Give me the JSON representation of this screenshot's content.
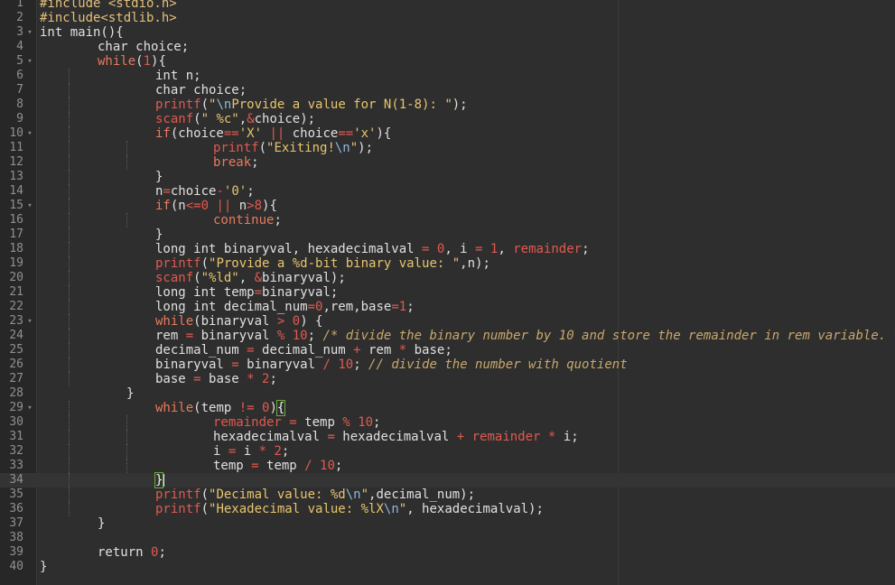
{
  "editor": {
    "lines": [
      {
        "n": "1",
        "fold": "",
        "indent": 0,
        "tokens": [
          [
            "pp",
            "#include <stdio.h>"
          ]
        ]
      },
      {
        "n": "2",
        "fold": "",
        "indent": 0,
        "tokens": [
          [
            "pp",
            "#include<stdlib.h>"
          ]
        ]
      },
      {
        "n": "3",
        "fold": "▾",
        "indent": 0,
        "tokens": [
          [
            "kw",
            "int main(){"
          ]
        ]
      },
      {
        "n": "4",
        "fold": "",
        "indent": 1,
        "tokens": [
          [
            "kw",
            "char choice;"
          ]
        ]
      },
      {
        "n": "5",
        "fold": "▾",
        "indent": 1,
        "tokens": [
          [
            "kwf",
            "while"
          ],
          [
            "kw",
            "("
          ],
          [
            "num",
            "1"
          ],
          [
            "kw",
            "){"
          ]
        ]
      },
      {
        "n": "6",
        "fold": "",
        "indent": 2,
        "tokens": [
          [
            "kw",
            "int n;"
          ]
        ]
      },
      {
        "n": "7",
        "fold": "",
        "indent": 2,
        "tokens": [
          [
            "kw",
            "char choice;"
          ]
        ]
      },
      {
        "n": "8",
        "fold": "",
        "indent": 2,
        "tokens": [
          [
            "fn",
            "printf"
          ],
          [
            "kw",
            "("
          ],
          [
            "str",
            "\""
          ],
          [
            "esc",
            "\\n"
          ],
          [
            "str",
            "Provide a value for N(1-8): \""
          ],
          [
            "kw",
            ");"
          ]
        ]
      },
      {
        "n": "9",
        "fold": "",
        "indent": 2,
        "tokens": [
          [
            "fn",
            "scanf"
          ],
          [
            "kw",
            "("
          ],
          [
            "str",
            "\" %c\""
          ],
          [
            "kw",
            ","
          ],
          [
            "op",
            "&"
          ],
          [
            "kw",
            "choice);"
          ]
        ]
      },
      {
        "n": "10",
        "fold": "▾",
        "indent": 2,
        "tokens": [
          [
            "kwf",
            "if"
          ],
          [
            "kw",
            "(choice"
          ],
          [
            "op",
            "=="
          ],
          [
            "str",
            "'X'"
          ],
          [
            "kw",
            " "
          ],
          [
            "op",
            "||"
          ],
          [
            "kw",
            " choice"
          ],
          [
            "op",
            "=="
          ],
          [
            "str",
            "'x'"
          ],
          [
            "kw",
            "){"
          ]
        ]
      },
      {
        "n": "11",
        "fold": "",
        "indent": 3,
        "tokens": [
          [
            "fn",
            "printf"
          ],
          [
            "kw",
            "("
          ],
          [
            "str",
            "\"Exiting!"
          ],
          [
            "esc",
            "\\n"
          ],
          [
            "str",
            "\""
          ],
          [
            "kw",
            ");"
          ]
        ]
      },
      {
        "n": "12",
        "fold": "",
        "indent": 3,
        "tokens": [
          [
            "kwf",
            "break"
          ],
          [
            "kw",
            ";"
          ]
        ]
      },
      {
        "n": "13",
        "fold": "",
        "indent": 2,
        "tokens": [
          [
            "kw",
            "}"
          ]
        ]
      },
      {
        "n": "14",
        "fold": "",
        "indent": 2,
        "tokens": [
          [
            "kw",
            "n"
          ],
          [
            "op",
            "="
          ],
          [
            "kw",
            "choice"
          ],
          [
            "op",
            "-"
          ],
          [
            "str",
            "'0'"
          ],
          [
            "kw",
            ";"
          ]
        ]
      },
      {
        "n": "15",
        "fold": "▾",
        "indent": 2,
        "tokens": [
          [
            "kwf",
            "if"
          ],
          [
            "kw",
            "(n"
          ],
          [
            "op",
            "<="
          ],
          [
            "num",
            "0"
          ],
          [
            "kw",
            " "
          ],
          [
            "op",
            "||"
          ],
          [
            "kw",
            " n"
          ],
          [
            "op",
            ">"
          ],
          [
            "num",
            "8"
          ],
          [
            "kw",
            "){"
          ]
        ]
      },
      {
        "n": "16",
        "fold": "",
        "indent": 3,
        "tokens": [
          [
            "kwf",
            "continue"
          ],
          [
            "kw",
            ";"
          ]
        ]
      },
      {
        "n": "17",
        "fold": "",
        "indent": 2,
        "tokens": [
          [
            "kw",
            "}"
          ]
        ]
      },
      {
        "n": "18",
        "fold": "",
        "indent": 2,
        "tokens": [
          [
            "kw",
            "long int binaryval, hexadecimalval "
          ],
          [
            "op",
            "="
          ],
          [
            "kw",
            " "
          ],
          [
            "num",
            "0"
          ],
          [
            "kw",
            ", i "
          ],
          [
            "op",
            "="
          ],
          [
            "kw",
            " "
          ],
          [
            "num",
            "1"
          ],
          [
            "kw",
            ", "
          ],
          [
            "red",
            "remainder"
          ],
          [
            "kw",
            ";"
          ]
        ]
      },
      {
        "n": "19",
        "fold": "",
        "indent": 2,
        "tokens": [
          [
            "fn",
            "printf"
          ],
          [
            "kw",
            "("
          ],
          [
            "str",
            "\"Provide a %d-bit binary value: \""
          ],
          [
            "kw",
            ",n);"
          ]
        ]
      },
      {
        "n": "20",
        "fold": "",
        "indent": 2,
        "tokens": [
          [
            "fn",
            "scanf"
          ],
          [
            "kw",
            "("
          ],
          [
            "str",
            "\"%ld\""
          ],
          [
            "kw",
            ", "
          ],
          [
            "op",
            "&"
          ],
          [
            "kw",
            "binaryval);"
          ]
        ]
      },
      {
        "n": "21",
        "fold": "",
        "indent": 2,
        "tokens": [
          [
            "kw",
            "long int temp"
          ],
          [
            "op",
            "="
          ],
          [
            "kw",
            "binaryval;"
          ]
        ]
      },
      {
        "n": "22",
        "fold": "",
        "indent": 2,
        "tokens": [
          [
            "kw",
            "long int decimal_num"
          ],
          [
            "op",
            "="
          ],
          [
            "num",
            "0"
          ],
          [
            "kw",
            ",rem,base"
          ],
          [
            "op",
            "="
          ],
          [
            "num",
            "1"
          ],
          [
            "kw",
            ";"
          ]
        ]
      },
      {
        "n": "23",
        "fold": "▾",
        "indent": 2,
        "tokens": [
          [
            "kwf",
            "while"
          ],
          [
            "kw",
            "(binaryval "
          ],
          [
            "op",
            ">"
          ],
          [
            "kw",
            " "
          ],
          [
            "num",
            "0"
          ],
          [
            "kw",
            ") {"
          ]
        ]
      },
      {
        "n": "24",
        "fold": "",
        "indent": 2,
        "tokens": [
          [
            "kw",
            "rem "
          ],
          [
            "op",
            "="
          ],
          [
            "kw",
            " binaryval "
          ],
          [
            "op",
            "%"
          ],
          [
            "kw",
            " "
          ],
          [
            "num",
            "10"
          ],
          [
            "kw",
            "; "
          ],
          [
            "cm",
            "/* divide the binary number by 10 and store the remainder in rem variable. */"
          ]
        ]
      },
      {
        "n": "25",
        "fold": "",
        "indent": 2,
        "tokens": [
          [
            "kw",
            "decimal_num "
          ],
          [
            "op",
            "="
          ],
          [
            "kw",
            " decimal_num "
          ],
          [
            "op",
            "+"
          ],
          [
            "kw",
            " rem "
          ],
          [
            "op",
            "*"
          ],
          [
            "kw",
            " base;"
          ]
        ]
      },
      {
        "n": "26",
        "fold": "",
        "indent": 2,
        "tokens": [
          [
            "kw",
            "binaryval "
          ],
          [
            "op",
            "="
          ],
          [
            "kw",
            " binaryval "
          ],
          [
            "op",
            "/"
          ],
          [
            "kw",
            " "
          ],
          [
            "num",
            "10"
          ],
          [
            "kw",
            "; "
          ],
          [
            "cm",
            "// divide the number with quotient"
          ]
        ]
      },
      {
        "n": "27",
        "fold": "",
        "indent": 2,
        "tokens": [
          [
            "kw",
            "base "
          ],
          [
            "op",
            "="
          ],
          [
            "kw",
            " base "
          ],
          [
            "op",
            "*"
          ],
          [
            "kw",
            " "
          ],
          [
            "num",
            "2"
          ],
          [
            "kw",
            ";"
          ]
        ]
      },
      {
        "n": "28",
        "fold": "",
        "indent": 1.5,
        "tokens": [
          [
            "kw",
            "}"
          ]
        ]
      },
      {
        "n": "29",
        "fold": "▾",
        "indent": 2,
        "tokens": [
          [
            "kwf",
            "while"
          ],
          [
            "kw",
            "(temp "
          ],
          [
            "op",
            "!="
          ],
          [
            "kw",
            " "
          ],
          [
            "num",
            "0"
          ],
          [
            "kw",
            ")"
          ],
          [
            "bm",
            "{"
          ]
        ]
      },
      {
        "n": "30",
        "fold": "",
        "indent": 3,
        "tokens": [
          [
            "red",
            "remainder"
          ],
          [
            "kw",
            " "
          ],
          [
            "op",
            "="
          ],
          [
            "kw",
            " temp "
          ],
          [
            "op",
            "%"
          ],
          [
            "kw",
            " "
          ],
          [
            "num",
            "10"
          ],
          [
            "kw",
            ";"
          ]
        ]
      },
      {
        "n": "31",
        "fold": "",
        "indent": 3,
        "tokens": [
          [
            "kw",
            "hexadecimalval "
          ],
          [
            "op",
            "="
          ],
          [
            "kw",
            " hexadecimalval "
          ],
          [
            "op",
            "+"
          ],
          [
            "kw",
            " "
          ],
          [
            "red",
            "remainder"
          ],
          [
            "kw",
            " "
          ],
          [
            "op",
            "*"
          ],
          [
            "kw",
            " i;"
          ]
        ]
      },
      {
        "n": "32",
        "fold": "",
        "indent": 3,
        "tokens": [
          [
            "kw",
            "i "
          ],
          [
            "op",
            "="
          ],
          [
            "kw",
            " i "
          ],
          [
            "op",
            "*"
          ],
          [
            "kw",
            " "
          ],
          [
            "num",
            "2"
          ],
          [
            "kw",
            ";"
          ]
        ]
      },
      {
        "n": "33",
        "fold": "",
        "indent": 3,
        "tokens": [
          [
            "kw",
            "temp "
          ],
          [
            "op",
            "="
          ],
          [
            "kw",
            " temp "
          ],
          [
            "op",
            "/"
          ],
          [
            "kw",
            " "
          ],
          [
            "num",
            "10"
          ],
          [
            "kw",
            ";"
          ]
        ]
      },
      {
        "n": "34",
        "fold": "",
        "indent": 2,
        "current": true,
        "tokens": [
          [
            "bm",
            "}"
          ],
          [
            "cursor",
            ""
          ]
        ]
      },
      {
        "n": "35",
        "fold": "",
        "indent": 2,
        "tokens": [
          [
            "fn",
            "printf"
          ],
          [
            "kw",
            "("
          ],
          [
            "str",
            "\"Decimal value: %d"
          ],
          [
            "esc",
            "\\n"
          ],
          [
            "str",
            "\""
          ],
          [
            "kw",
            ",decimal_num);"
          ]
        ]
      },
      {
        "n": "36",
        "fold": "",
        "indent": 2,
        "tokens": [
          [
            "fn",
            "printf"
          ],
          [
            "kw",
            "("
          ],
          [
            "str",
            "\"Hexadecimal value: %lX"
          ],
          [
            "esc",
            "\\n"
          ],
          [
            "str",
            "\""
          ],
          [
            "kw",
            ", hexadecimalval);"
          ]
        ]
      },
      {
        "n": "37",
        "fold": "",
        "indent": 1,
        "tokens": [
          [
            "kw",
            "}"
          ]
        ]
      },
      {
        "n": "38",
        "fold": "",
        "indent": 1,
        "tokens": []
      },
      {
        "n": "39",
        "fold": "",
        "indent": 1,
        "tokens": [
          [
            "kw",
            "return "
          ],
          [
            "num",
            "0"
          ],
          [
            "kw",
            ";"
          ]
        ]
      },
      {
        "n": "40",
        "fold": "",
        "indent": 0,
        "tokens": [
          [
            "kw",
            "}"
          ]
        ]
      }
    ]
  },
  "colors": {
    "background": "#2e2e2e",
    "gutter": "#272727",
    "function": "#e05a4f",
    "string": "#e8c56e",
    "comment": "#c8a86b",
    "preprocessor": "#e4c07a"
  }
}
